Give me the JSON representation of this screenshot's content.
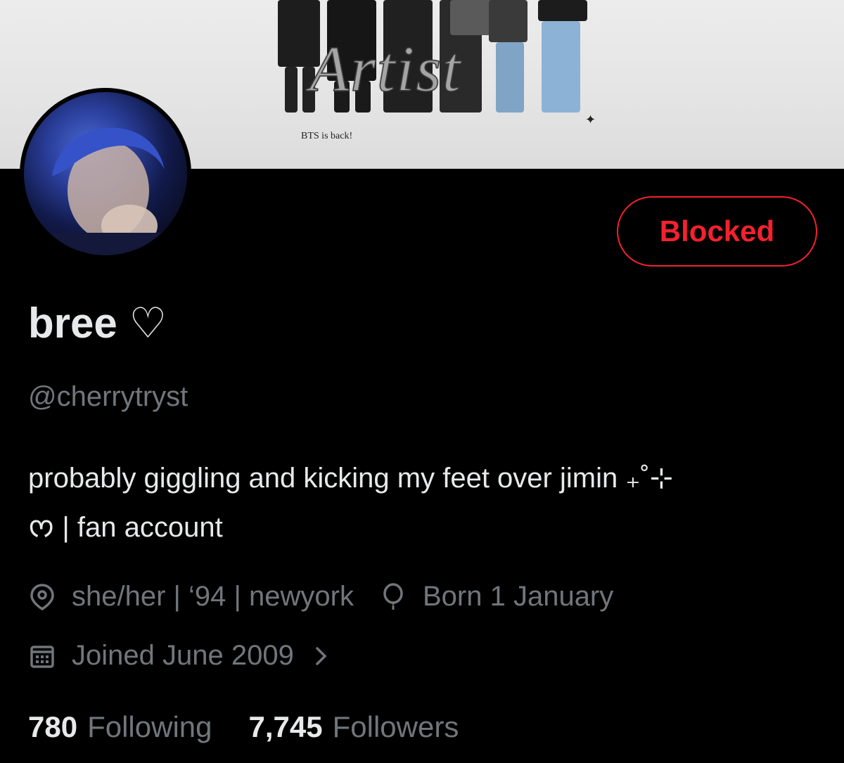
{
  "banner": {
    "title": "Artist",
    "caption": "BTS is back!"
  },
  "profile": {
    "display_name": "bree ♡",
    "handle": "@cherrytryst",
    "bio_line1": "probably giggling and kicking my feet over jimin ₊˚⊹",
    "bio_line2": "ᰔ | fan account",
    "location": "she/her | ‘94 | newyork",
    "birthday": "Born 1 January",
    "joined": "Joined June 2009"
  },
  "action": {
    "blocked_label": "Blocked"
  },
  "stats": {
    "following_count": "780",
    "following_label": "Following",
    "followers_count": "7,745",
    "followers_label": "Followers"
  },
  "colors": {
    "background": "#000000",
    "text_primary": "#e7e9ea",
    "text_secondary": "#71767b",
    "blocked_red": "#f4212e"
  },
  "icons": {
    "location": "location-pin-icon",
    "birthday": "balloon-icon",
    "joined": "calendar-icon",
    "expand": "chevron-right-icon"
  }
}
